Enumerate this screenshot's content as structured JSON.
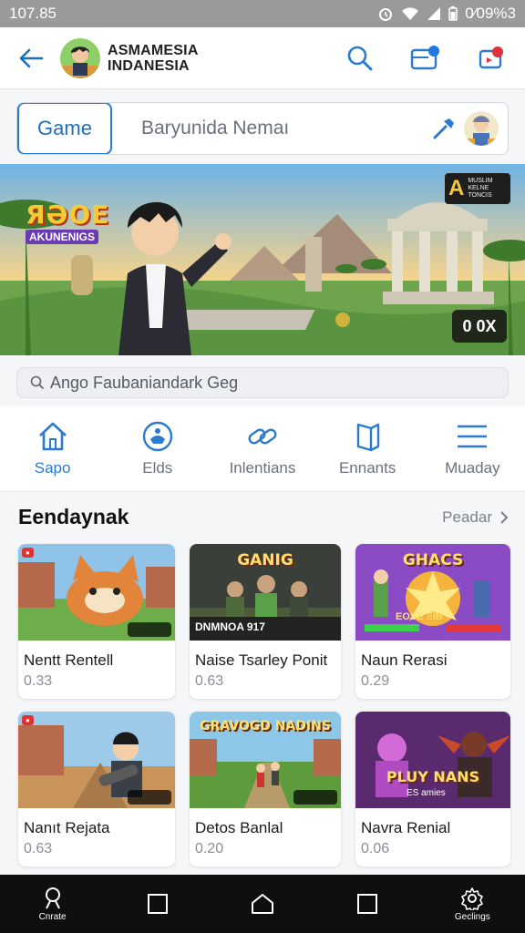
{
  "status": {
    "time": "107.85",
    "battery_text": "0⁄09%3"
  },
  "header": {
    "brand_line1": "ASMAMESIA",
    "brand_line2": "INDANESIA"
  },
  "search": {
    "segment_label": "Game",
    "placeholder": "Baryunida Nemaı"
  },
  "banner": {
    "logo_title": "ЯƏOE",
    "logo_subtitle": "AKUNENIGS",
    "badge_letter": "A",
    "badge_small": "MUSLIM KELNE TONCIS",
    "score": "0 0X"
  },
  "search2": {
    "placeholder": "Ango Faubaniandark Geg"
  },
  "categories": [
    {
      "label": "Sapo",
      "icon": "home-icon",
      "active": true
    },
    {
      "label": "Elds",
      "icon": "controller-icon",
      "active": false
    },
    {
      "label": "Inlentians",
      "icon": "link-icon",
      "active": false
    },
    {
      "label": "Ennants",
      "icon": "book-icon",
      "active": false
    },
    {
      "label": "Muaday",
      "icon": "menu-icon",
      "active": false
    }
  ],
  "section": {
    "title": "Eendaynak",
    "more_label": "Peadar"
  },
  "games": [
    {
      "name": "Nentt Rentell",
      "price": "0.33",
      "art_title": "",
      "theme": "cat"
    },
    {
      "name": "Naise Tsarley Ponit",
      "price": "0.63",
      "art_title": "GANIG",
      "theme": "soldiers",
      "art_footer": "DNMNOA 917"
    },
    {
      "name": "Naun Rerasi",
      "price": "0.29",
      "art_title": "GHACS",
      "theme": "fight",
      "art_footer": "EOSE ΞIB"
    },
    {
      "name": "Nanıt Rejata",
      "price": "0.63",
      "art_title": "",
      "theme": "boy"
    },
    {
      "name": "Detos Banlal",
      "price": "0.20",
      "art_title": "GRAVOGD NADINS",
      "theme": "village"
    },
    {
      "name": "Navra Renial",
      "price": "0.06",
      "art_title": "PLUY NANS",
      "theme": "heroes",
      "art_footer": "ES amies"
    }
  ],
  "bottom_nav": [
    {
      "label": "Cnrate",
      "icon": "search-person-icon"
    },
    {
      "label": "",
      "icon": "square-icon"
    },
    {
      "label": "",
      "icon": "home-icon"
    },
    {
      "label": "",
      "icon": "square-icon"
    },
    {
      "label": "Geclings",
      "icon": "gear-icon"
    }
  ],
  "colors": {
    "accent": "#2a7bd0",
    "bottom_bar": "#0f0f10",
    "status_bar": "#9a9a9a"
  }
}
